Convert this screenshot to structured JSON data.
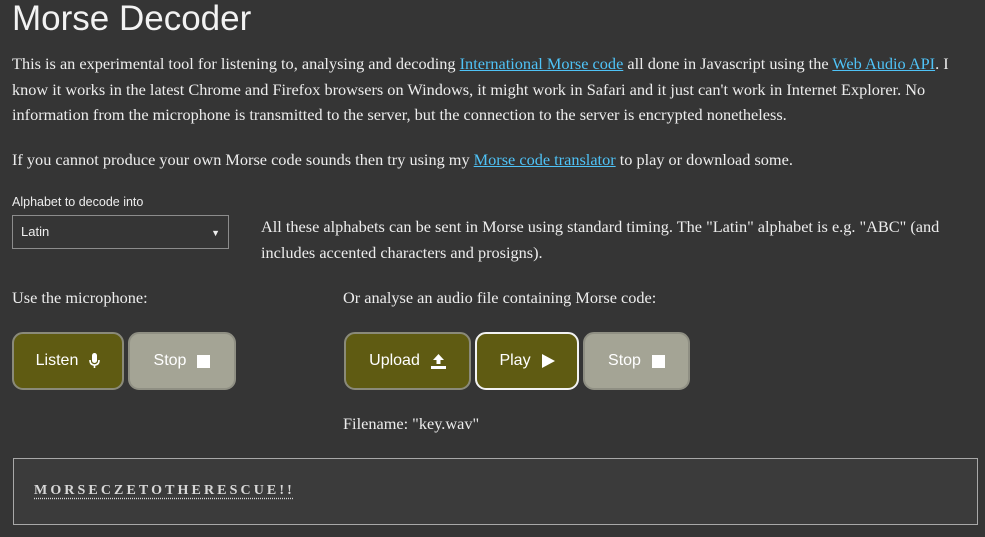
{
  "page": {
    "title": "Morse Decoder"
  },
  "intro": {
    "text_1": "This is an experimental tool for listening to, analysing and decoding ",
    "link_morse": "International Morse code",
    "text_2": " all done in Javascript using the ",
    "link_webaudio": "Web Audio API",
    "text_3": ". I know it works in the latest Chrome and Firefox browsers on Windows, it might work in Safari and it just can't work in Internet Explorer. No information from the microphone is transmitted to the server, but the connection to the server is encrypted nonetheless."
  },
  "note": {
    "text_1": "If you cannot produce your own Morse code sounds then try using my ",
    "link_translator": "Morse code translator",
    "text_2": " to play or download some."
  },
  "alphabet": {
    "label": "Alphabet to decode into",
    "selected": "Latin",
    "description": "All these alphabets can be sent in Morse using standard timing. The \"Latin\" alphabet is e.g. \"ABC\" (and includes accented characters and prosigns)."
  },
  "microphone": {
    "label": "Use the microphone:",
    "listen_label": "Listen",
    "stop_label": "Stop"
  },
  "audio_file": {
    "label": "Or analyse an audio file containing Morse code:",
    "upload_label": "Upload",
    "play_label": "Play",
    "stop_label": "Stop",
    "filename_text": "Filename: \"key.wav\""
  },
  "output": {
    "decoded_text": "MORSECZETOTHERESCUE!!"
  },
  "colors": {
    "background": "#353535",
    "link": "#4fc3f7",
    "button_active": "#5f5b12",
    "button_inactive": "#a4a495"
  },
  "icons": {
    "listen": "microphone-icon",
    "stop": "stop-square-icon",
    "upload": "upload-icon",
    "play": "play-icon",
    "dropdown": "caret-down-icon"
  }
}
